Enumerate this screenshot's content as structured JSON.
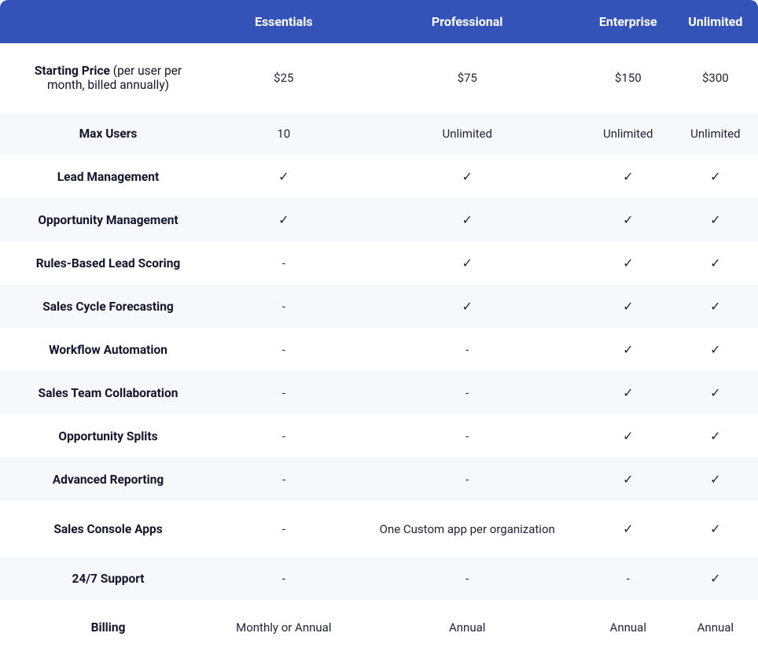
{
  "header": {
    "blank": "",
    "plans": [
      "Essentials",
      "Professional",
      "Enterprise",
      "Unlimited"
    ]
  },
  "symbols": {
    "check": "✓",
    "dash": "-"
  },
  "chart_data": {
    "type": "table",
    "title": "",
    "columns": [
      "",
      "Essentials",
      "Professional",
      "Enterprise",
      "Unlimited"
    ],
    "rows": [
      {
        "label": "Starting Price",
        "label_note": " (per user per month, billed annually)",
        "cells": [
          "$25",
          "$75",
          "$150",
          "$300"
        ]
      },
      {
        "label": "Max Users",
        "cells": [
          "10",
          "Unlimited",
          "Unlimited",
          "Unlimited"
        ]
      },
      {
        "label": "Lead Management",
        "cells": [
          "check",
          "check",
          "check",
          "check"
        ]
      },
      {
        "label": "Opportunity Management",
        "cells": [
          "check",
          "check",
          "check",
          "check"
        ]
      },
      {
        "label": "Rules-Based Lead Scoring",
        "cells": [
          "dash",
          "check",
          "check",
          "check"
        ]
      },
      {
        "label": "Sales Cycle Forecasting",
        "cells": [
          "dash",
          "check",
          "check",
          "check"
        ]
      },
      {
        "label": "Workflow Automation",
        "cells": [
          "dash",
          "dash",
          "check",
          "check"
        ]
      },
      {
        "label": "Sales Team Collaboration",
        "cells": [
          "dash",
          "dash",
          "check",
          "check"
        ]
      },
      {
        "label": "Opportunity Splits",
        "cells": [
          "dash",
          "dash",
          "check",
          "check"
        ]
      },
      {
        "label": "Advanced Reporting",
        "cells": [
          "dash",
          "dash",
          "check",
          "check"
        ]
      },
      {
        "label": "Sales Console Apps",
        "cells": [
          "dash",
          "One Custom app per organization",
          "check",
          "check"
        ]
      },
      {
        "label": "24/7 Support",
        "cells": [
          "dash",
          "dash",
          "dash",
          "check"
        ]
      },
      {
        "label": "Billing",
        "cells": [
          "Monthly or Annual",
          "Annual",
          "Annual",
          "Annual"
        ]
      }
    ]
  }
}
